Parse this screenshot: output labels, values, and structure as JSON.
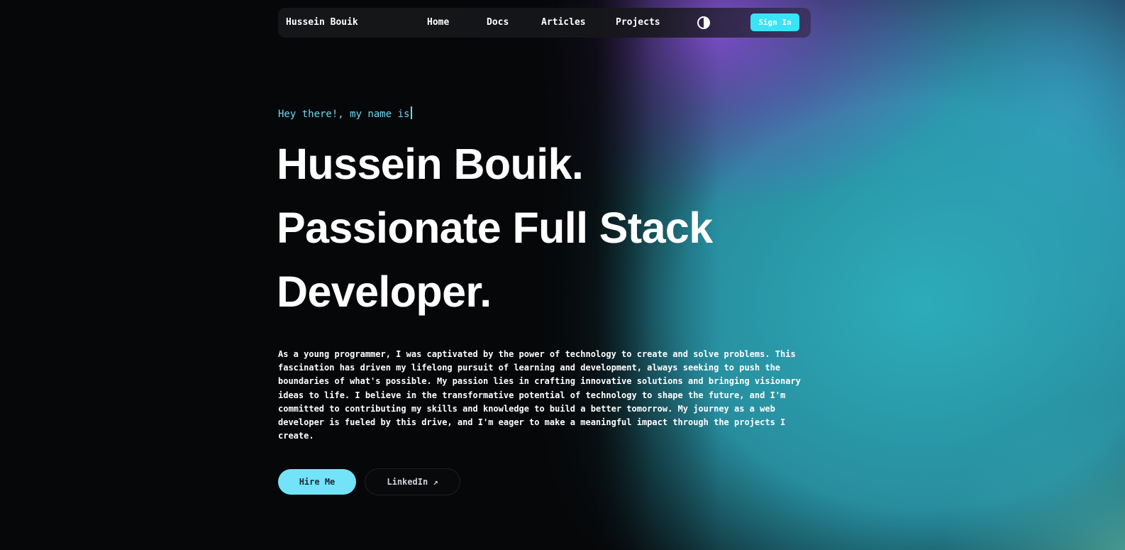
{
  "nav": {
    "brand": "Hussein Bouik",
    "links": [
      "Home",
      "Docs",
      "Articles",
      "Projects"
    ],
    "theme_icon": "contrast-half-circle-icon",
    "signin_label": "Sign In"
  },
  "hero": {
    "greeting": "Hey there!, my name is",
    "headline_lines": [
      "Hussein Bouik.",
      "Passionate Full Stack",
      "Developer."
    ],
    "bio": "As a young programmer, I was captivated by the power of technology to create and solve problems. This fascination has driven my lifelong pursuit of learning and development, always seeking to push the boundaries of what's possible. My passion lies in crafting innovative solutions and bringing visionary ideas to life. I believe in the transformative potential of technology to shape the future, and I'm committed to contributing my skills and knowledge to build a better tomorrow. My journey as a web developer is fueled by this drive, and I'm eager to make a meaningful impact through the projects I create.",
    "hire_label": "Hire Me",
    "linkedin_label": "LinkedIn ↗"
  },
  "colors": {
    "accent": "#38e4f7",
    "hire_button": "#73e3fa",
    "greeting": "#6fd8ee",
    "background": "#060709"
  }
}
